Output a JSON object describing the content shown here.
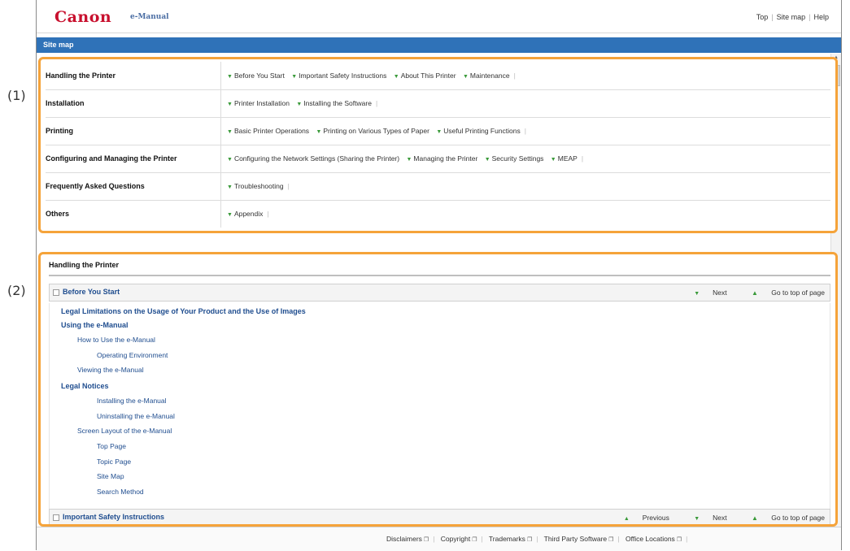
{
  "callouts": {
    "one": "(1)",
    "two": "(2)"
  },
  "header": {
    "logo": "Canon",
    "product": "e-Manual",
    "links": [
      "Top",
      "Site map",
      "Help"
    ]
  },
  "bar": {
    "title": "Site map"
  },
  "sitemap": {
    "rows": [
      {
        "category": "Handling the Printer",
        "links": [
          "Before You Start",
          "Important Safety Instructions",
          "About This Printer",
          "Maintenance"
        ]
      },
      {
        "category": "Installation",
        "links": [
          "Printer Installation",
          "Installing the Software"
        ]
      },
      {
        "category": "Printing",
        "links": [
          "Basic Printer Operations",
          "Printing on Various Types of Paper",
          "Useful Printing Functions"
        ]
      },
      {
        "category": "Configuring and Managing the Printer",
        "links": [
          "Configuring the Network Settings (Sharing the Printer)",
          "Managing the Printer",
          "Security Settings",
          "MEAP"
        ]
      },
      {
        "category": "Frequently Asked Questions",
        "links": [
          "Troubleshooting"
        ]
      },
      {
        "category": "Others",
        "links": [
          "Appendix"
        ]
      }
    ]
  },
  "handling": {
    "title": "Handling the Printer",
    "section1": {
      "title": "Before You Start",
      "next": "Next",
      "top": "Go to top of page"
    },
    "tree": [
      "Legal Limitations on the Usage of Your Product and the Use of Images",
      "Using the e-Manual",
      "How to Use the e-Manual",
      "Operating Environment",
      "Viewing the e-Manual",
      "Legal Notices",
      "Installing the e-Manual",
      "Uninstalling the e-Manual",
      "Screen Layout of the e-Manual",
      "Top Page",
      "Topic Page",
      "Site Map",
      "Search Method"
    ],
    "section2": {
      "title": "Important Safety Instructions",
      "previous": "Previous",
      "next": "Next",
      "top": "Go to top of page"
    }
  },
  "footer": {
    "links": [
      "Disclaimers",
      "Copyright",
      "Trademarks",
      "Third Party Software",
      "Office Locations"
    ]
  },
  "colors": {
    "accent_bar": "#2f72b8",
    "highlight": "#f5a33a",
    "logo": "#c8102e"
  }
}
